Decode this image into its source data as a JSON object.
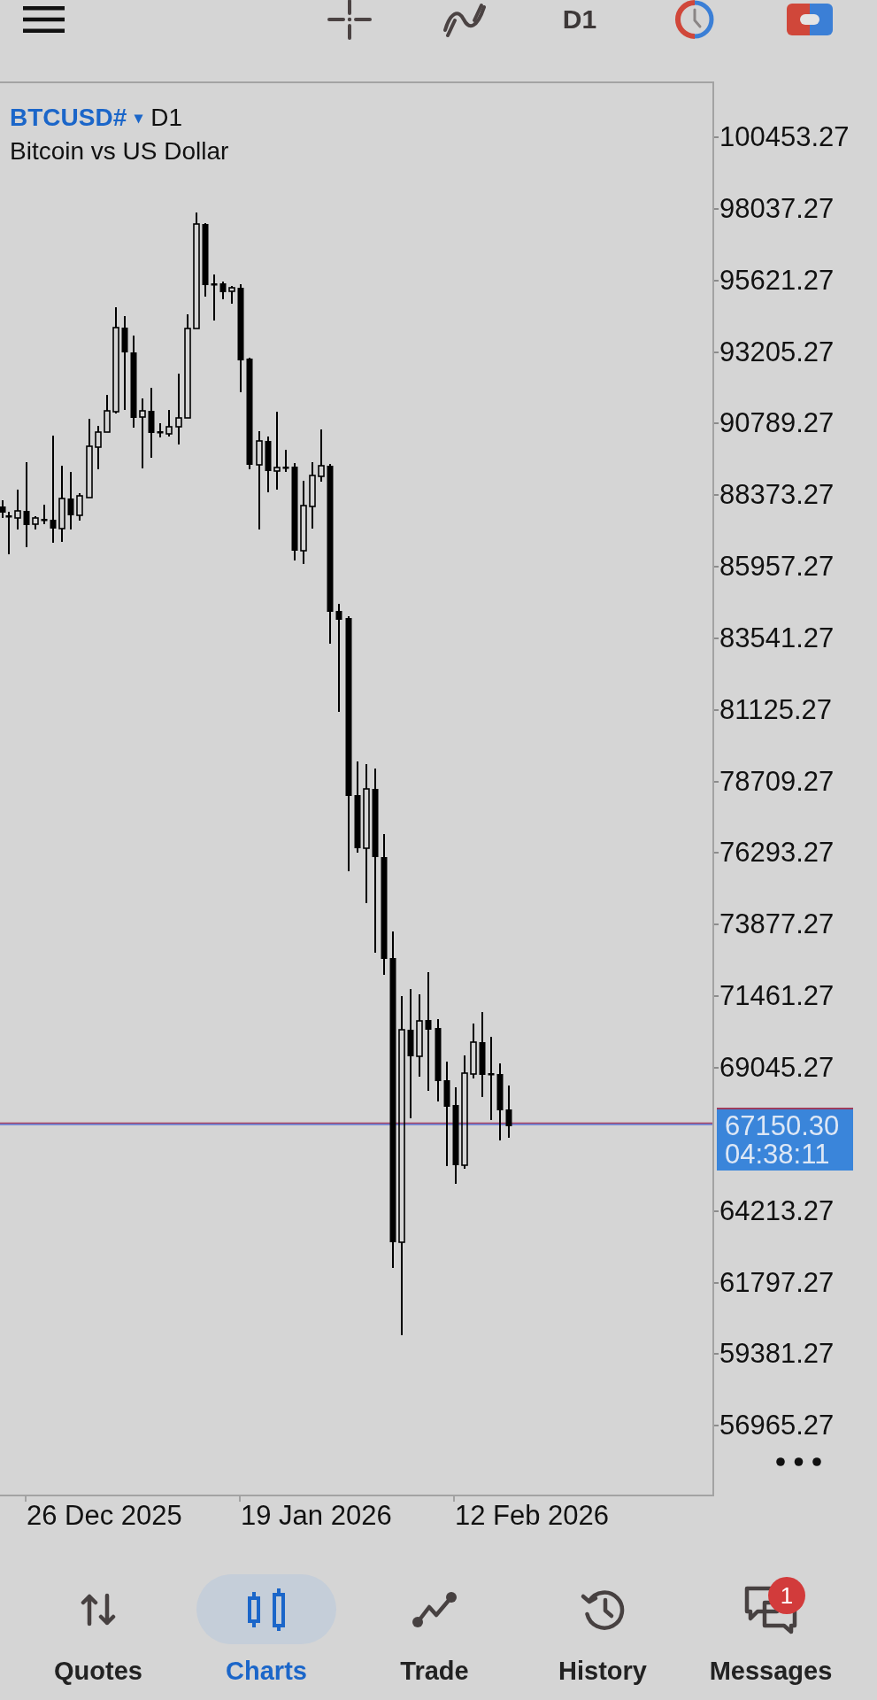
{
  "toolbar": {
    "timeframe": "D1"
  },
  "chart": {
    "symbol": "BTCUSD#",
    "symbol_caret": "▾",
    "timeframe": "D1",
    "description": "Bitcoin vs US Dollar",
    "price_axis": {
      "upper": [
        "100453.27",
        "98037.27",
        "95621.27",
        "93205.27",
        "90789.27",
        "88373.27",
        "85957.27",
        "83541.27",
        "81125.27",
        "78709.27",
        "76293.27",
        "73877.27",
        "71461.27",
        "69045.27"
      ],
      "lower": [
        "64213.27",
        "61797.27",
        "59381.27",
        "56965.27"
      ]
    },
    "current_price": {
      "price": "67150.30",
      "countdown": "04:38:11"
    },
    "time_axis": [
      "26 Dec 2025",
      "19 Jan 2026",
      "12 Feb 2026"
    ]
  },
  "bottom_nav": [
    {
      "label": "Quotes",
      "selected": false
    },
    {
      "label": "Charts",
      "selected": true
    },
    {
      "label": "Trade",
      "selected": false
    },
    {
      "label": "History",
      "selected": false
    },
    {
      "label": "Messages",
      "selected": false,
      "badge": "1"
    }
  ]
}
